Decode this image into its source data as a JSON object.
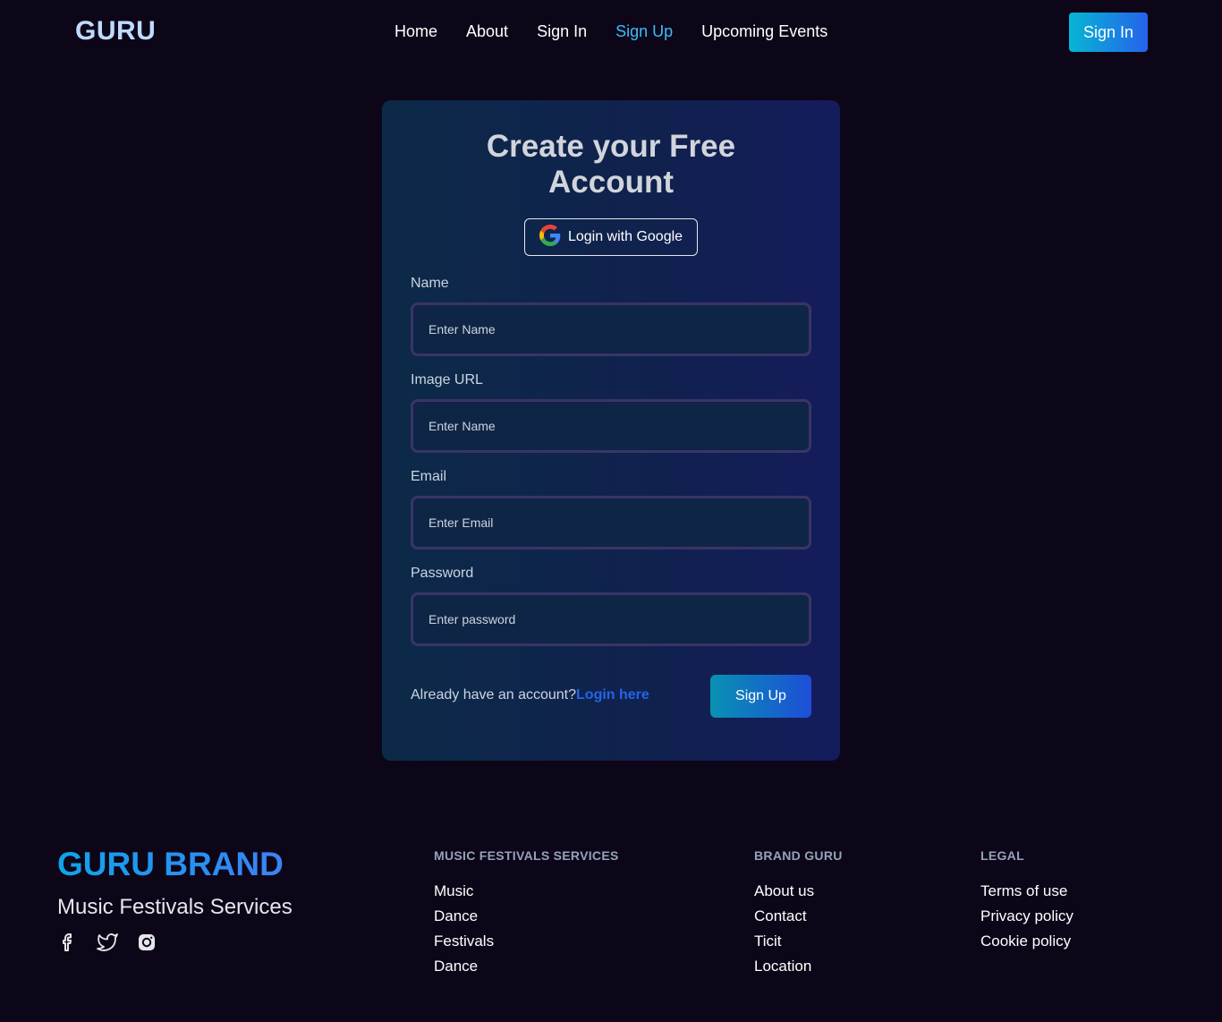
{
  "navbar": {
    "brand": "GURU",
    "links": [
      {
        "label": "Home",
        "active": false
      },
      {
        "label": "About",
        "active": false
      },
      {
        "label": "Sign In",
        "active": false
      },
      {
        "label": "Sign Up",
        "active": true
      },
      {
        "label": "Upcoming Events",
        "active": false
      }
    ],
    "cta_label": "Sign In"
  },
  "form": {
    "title_line1": "Create your Free",
    "title_line2": "Account",
    "google_label": "Login with Google",
    "fields": [
      {
        "label": "Name",
        "placeholder": "Enter Name"
      },
      {
        "label": "Image URL",
        "placeholder": "Enter Name"
      },
      {
        "label": "Email",
        "placeholder": "Enter Email"
      },
      {
        "label": "Password",
        "placeholder": "Enter password"
      }
    ],
    "already_text": "Already have an account?",
    "login_link": "Login here",
    "submit_label": "Sign Up"
  },
  "footer": {
    "brand": "GURU BRAND",
    "tagline": "Music Festivals Services",
    "socials": [
      "facebook-icon",
      "twitter-icon",
      "instagram-icon"
    ],
    "columns": [
      {
        "title": "MUSIC FESTIVALS SERVICES",
        "links": [
          "Music",
          "Dance",
          "Festivals",
          "Dance"
        ]
      },
      {
        "title": "BRAND GURU",
        "links": [
          "About us",
          "Contact",
          "Ticit",
          "Location"
        ]
      },
      {
        "title": "LEGAL",
        "links": [
          "Terms of use",
          "Privacy policy",
          "Cookie policy"
        ]
      }
    ]
  },
  "colors": {
    "background": "#0d0619",
    "accent_start": "#06b6d4",
    "accent_end": "#2563eb",
    "active_link": "#38bdf8"
  }
}
